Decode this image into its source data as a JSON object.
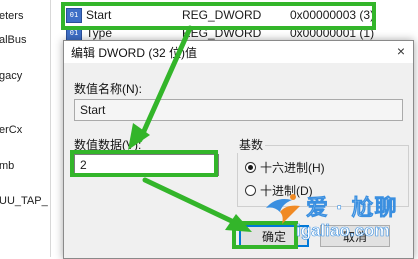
{
  "tree": {
    "items": [
      "eters",
      "alBus",
      "gacy",
      "erCx",
      "mb",
      "UU_TAP_"
    ]
  },
  "values": {
    "rows": [
      {
        "name": "Start",
        "type": "REG_DWORD",
        "data": "0x00000003 (3)"
      },
      {
        "name": "Type",
        "type": "REG_DWORD",
        "data": "0x00000001 (1)"
      }
    ]
  },
  "dialog": {
    "title": "编辑 DWORD (32 位)值",
    "close_glyph": "×",
    "name_label": "数值名称(N):",
    "name_value": "Start",
    "data_label": "数值数据(V):",
    "data_value": "2",
    "base_label": "基数",
    "radio_hex": "十六进制(H)",
    "radio_dec": "十进制(D)",
    "ok_label": "确定",
    "cancel_label": "取消"
  },
  "watermark": {
    "title": "爱 · 尬聊",
    "url": "igaliao.com"
  },
  "colors": {
    "highlight": "#33b52a",
    "accent": "#0078d7",
    "watermark": "#3a8fe0",
    "watermark_orange": "#f08a24"
  }
}
